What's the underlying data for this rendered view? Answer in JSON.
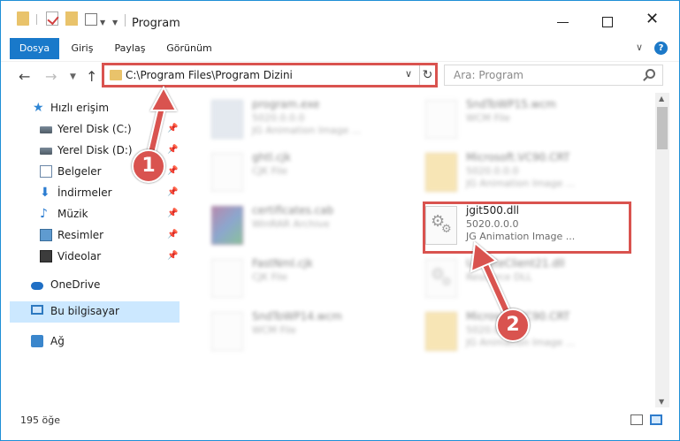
{
  "window": {
    "title": "Program",
    "minimize": "—",
    "close": "✕"
  },
  "ribbon": {
    "tabs": [
      "Dosya",
      "Giriş",
      "Paylaş",
      "Görünüm"
    ],
    "help": "?",
    "expand": "∨"
  },
  "address": {
    "path": "C:\\Program Files\\Program Dizini",
    "search_placeholder": "Ara: Program"
  },
  "sidebar": {
    "items": [
      {
        "label": "Hızlı erişim",
        "icon": "star-icon"
      },
      {
        "label": "Yerel Disk (C:)",
        "icon": "drive-icon",
        "pinned": true
      },
      {
        "label": "Yerel Disk (D:)",
        "icon": "drive-icon",
        "pinned": true
      },
      {
        "label": "Belgeler",
        "icon": "documents-icon",
        "pinned": true
      },
      {
        "label": "İndirmeler",
        "icon": "download-icon",
        "pinned": true
      },
      {
        "label": "Müzik",
        "icon": "music-icon",
        "pinned": true
      },
      {
        "label": "Resimler",
        "icon": "pictures-icon",
        "pinned": true
      },
      {
        "label": "Videolar",
        "icon": "videos-icon",
        "pinned": true
      },
      {
        "label": "OneDrive",
        "icon": "cloud-icon"
      },
      {
        "label": "Bu bilgisayar",
        "icon": "computer-icon",
        "selected": true
      },
      {
        "label": "Ağ",
        "icon": "network-icon"
      }
    ]
  },
  "files": [
    {
      "name": "program.exe",
      "line1": "5020.0.0.0",
      "line2": "JG Animation Image ...",
      "icon": "exe-icon"
    },
    {
      "name": "SndToWP15.wcm",
      "line1": "WCM File",
      "line2": "",
      "icon": "file-icon"
    },
    {
      "name": "ghtl.cjk",
      "line1": "CJK File",
      "line2": "",
      "icon": "file-icon"
    },
    {
      "name": "Microsoft.VC90.CRT",
      "line1": "5020.0.0.0",
      "line2": "JG Animation Image ...",
      "icon": "folder-icon"
    },
    {
      "name": "certificates.cab",
      "line1": "WinRAR Archive",
      "line2": "",
      "icon": "winrar-icon"
    },
    {
      "name": "jgit500.dll",
      "line1": "5020.0.0.0",
      "line2": "JG Animation Image ...",
      "icon": "dll-icon"
    },
    {
      "name": "FastNml.cjk",
      "line1": "CJK File",
      "line2": "",
      "icon": "file-icon"
    },
    {
      "name": "UpdateClient21.dll",
      "line1": "Resource DLL",
      "line2": "",
      "icon": "dll-icon"
    },
    {
      "name": "SndToWP14.wcm",
      "line1": "WCM File",
      "line2": "",
      "icon": "file-icon"
    },
    {
      "name": "Microsoft.VC90.CRT",
      "line1": "5020.0.0.0",
      "line2": "JG Animation Image ...",
      "icon": "folder-icon"
    }
  ],
  "status": {
    "count": "195 öğe"
  },
  "annotations": {
    "step1": "1",
    "step2": "2",
    "color": "#d9534f"
  }
}
